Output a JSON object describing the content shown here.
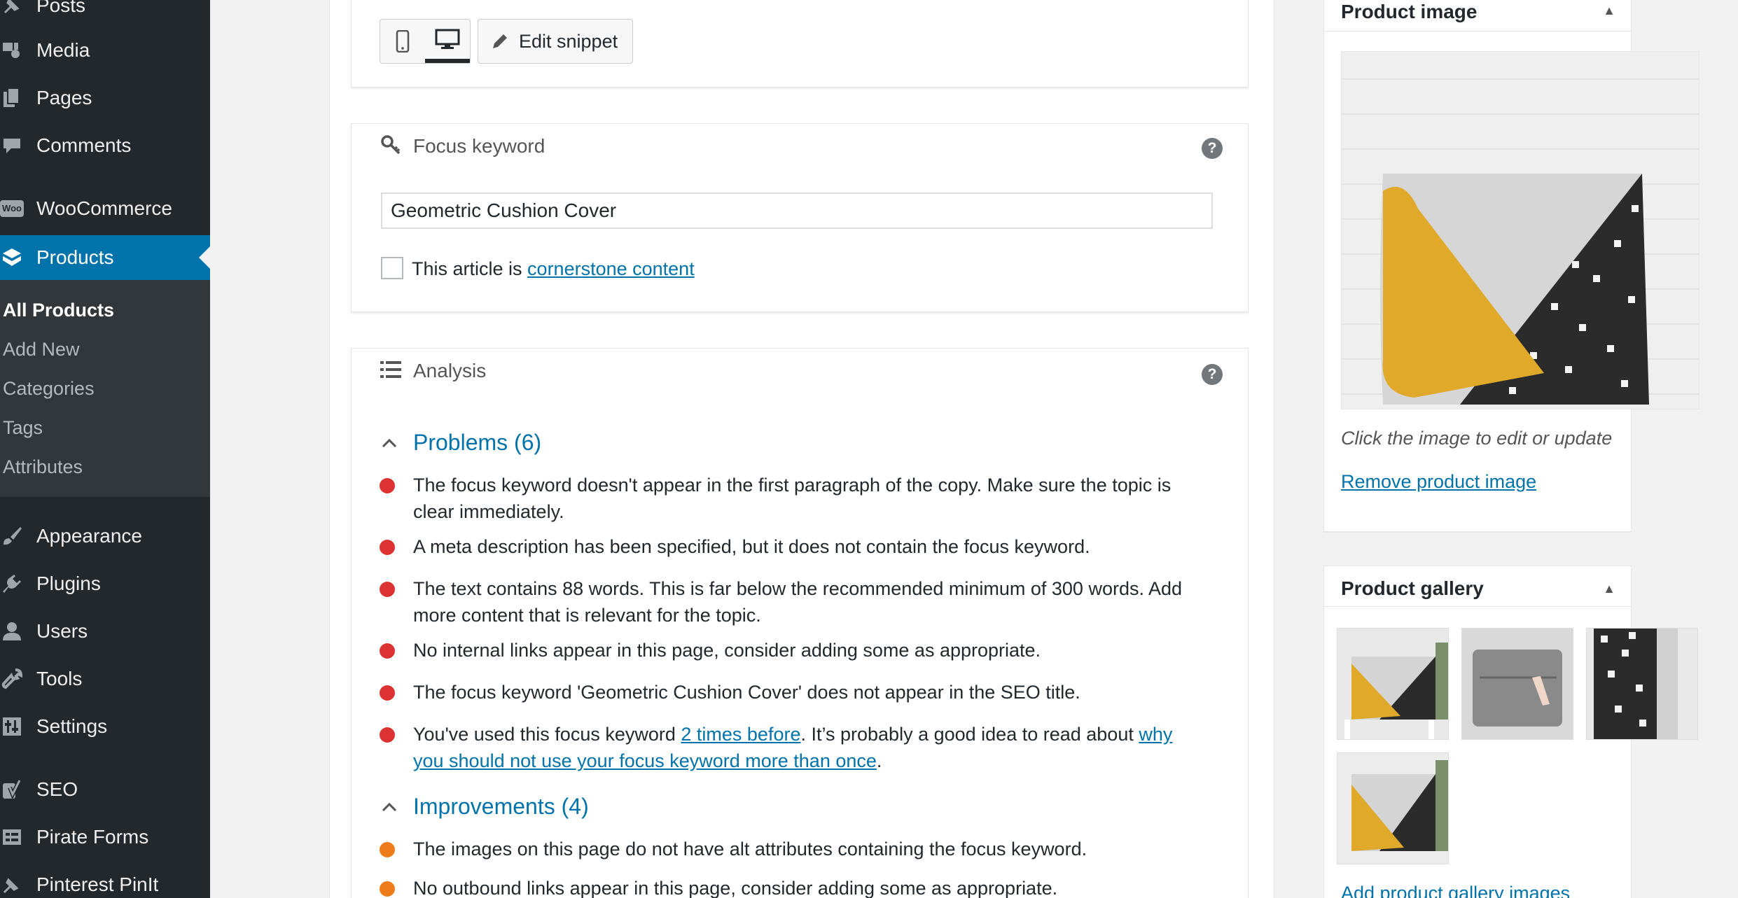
{
  "sidebar": {
    "items": [
      {
        "label": "Posts",
        "icon": "pin-icon"
      },
      {
        "label": "Media",
        "icon": "media-icon"
      },
      {
        "label": "Pages",
        "icon": "pages-icon"
      },
      {
        "label": "Comments",
        "icon": "comment-icon"
      },
      {
        "label": "WooCommerce",
        "icon": "woo-icon"
      },
      {
        "label": "Products",
        "icon": "products-icon"
      },
      {
        "label": "Appearance",
        "icon": "brush-icon"
      },
      {
        "label": "Plugins",
        "icon": "plug-icon"
      },
      {
        "label": "Users",
        "icon": "user-icon"
      },
      {
        "label": "Tools",
        "icon": "wrench-icon"
      },
      {
        "label": "Settings",
        "icon": "sliders-icon"
      },
      {
        "label": "SEO",
        "icon": "yoast-icon"
      },
      {
        "label": "Pirate Forms",
        "icon": "form-icon"
      },
      {
        "label": "Pinterest PinIt",
        "icon": "pinterest-icon"
      }
    ],
    "products_submenu": [
      "All Products",
      "Add New",
      "Categories",
      "Tags",
      "Attributes"
    ],
    "woo_badge": "Woo"
  },
  "snippet": {
    "edit_label": "Edit snippet"
  },
  "focus_keyword": {
    "title": "Focus keyword",
    "value": "Geometric Cushion Cover",
    "cornerstone_prefix": "This article is ",
    "cornerstone_link": "cornerstone content",
    "help": "?"
  },
  "analysis": {
    "title": "Analysis",
    "help": "?",
    "problems_title": "Problems (6)",
    "problems": [
      "The focus keyword doesn't appear in the first paragraph of the copy. Make sure the topic is clear immediately.",
      "A meta description has been specified, but it does not contain the focus keyword.",
      "The text contains 88 words. This is far below the recommended minimum of 300 words. Add more content that is relevant for the topic.",
      "No internal links appear in this page, consider adding some as appropriate.",
      "The focus keyword 'Geometric Cushion Cover' does not appear in the SEO title."
    ],
    "problem6": {
      "part1": "You've used this focus keyword ",
      "link1": "2 times before",
      "part2": ". It’s probably a good idea to read about ",
      "link2": "why you should not use your focus keyword more than once",
      "part3": "."
    },
    "improvements_title": "Improvements (4)",
    "improvements": [
      "The images on this page do not have alt attributes containing the focus keyword.",
      "No outbound links appear in this page, consider adding some as appropriate."
    ]
  },
  "product_image": {
    "title": "Product image",
    "caption": "Click the image to edit or update",
    "remove_link": "Remove product image",
    "toggle": "▲"
  },
  "product_gallery": {
    "title": "Product gallery",
    "add_link": "Add product gallery images",
    "toggle": "▲"
  },
  "colors": {
    "sidebar_bg": "#23282d",
    "active_blue": "#0073aa",
    "problem_red": "#dc3232",
    "improvement_orange": "#ee7c1b",
    "mustard": "#e0a92a"
  }
}
